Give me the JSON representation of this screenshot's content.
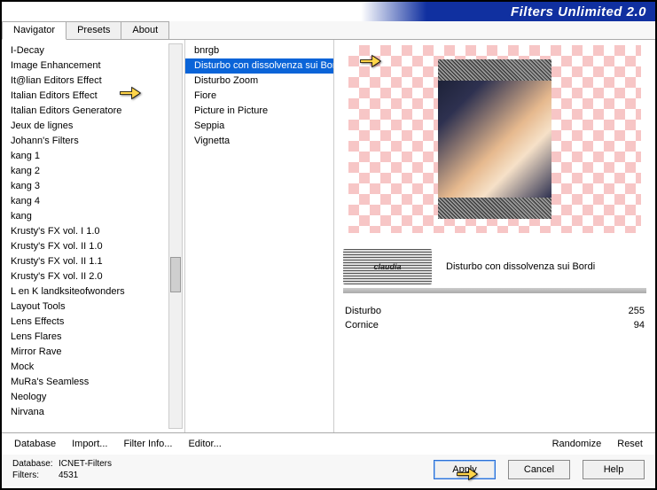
{
  "title": "Filters Unlimited 2.0",
  "tabs": {
    "navigator": "Navigator",
    "presets": "Presets",
    "about": "About"
  },
  "categories": [
    "I-Decay",
    "Image Enhancement",
    "It@lian Editors Effect",
    "Italian Editors Effect",
    "Italian Editors Generatore",
    "Jeux de lignes",
    "Johann's Filters",
    "kang 1",
    "kang 2",
    "kang 3",
    "kang 4",
    "kang",
    "Krusty's FX vol. I 1.0",
    "Krusty's FX vol. II 1.0",
    "Krusty's FX vol. II 1.1",
    "Krusty's FX vol. II 2.0",
    "L en K landksiteofwonders",
    "Layout Tools",
    "Lens Effects",
    "Lens Flares",
    "Mirror Rave",
    "Mock",
    "MuRa's Seamless",
    "Neology",
    "Nirvana"
  ],
  "filters": [
    "bnrgb",
    "Disturbo con dissolvenza sui Bordi",
    "Disturbo Zoom",
    "Fiore",
    "Picture in Picture",
    "Seppia",
    "Vignetta"
  ],
  "selected_filter": "Disturbo con dissolvenza sui Bordi",
  "watermark_label": "claudia",
  "params": [
    {
      "name": "Disturbo",
      "value": "255"
    },
    {
      "name": "Cornice",
      "value": "94"
    }
  ],
  "toolbar": {
    "database": "Database",
    "import": "Import...",
    "filterinfo": "Filter Info...",
    "editor": "Editor...",
    "randomize": "Randomize",
    "reset": "Reset"
  },
  "meta": {
    "db_label": "Database:",
    "db_value": "ICNET-Filters",
    "filters_label": "Filters:",
    "filters_value": "4531"
  },
  "buttons": {
    "apply": "Apply",
    "cancel": "Cancel",
    "help": "Help"
  }
}
